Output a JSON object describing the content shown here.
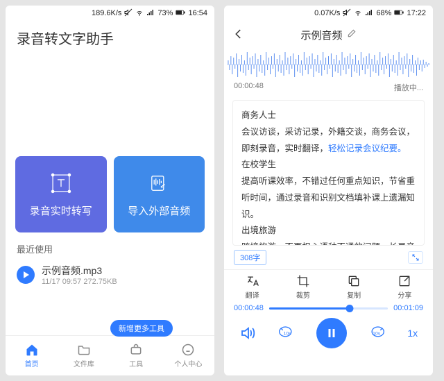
{
  "left": {
    "status": {
      "net": "189.6K/s",
      "battery": "73%",
      "time": "16:54"
    },
    "title": "录音转文字助手",
    "cards": {
      "record": "录音实时转写",
      "import": "导入外部音频"
    },
    "recent_label": "最近使用",
    "recent": {
      "name": "示例音频.mp3",
      "meta": "11/17 09:57   272.75KB"
    },
    "badge": "新增更多工具",
    "tabs": {
      "home": "首页",
      "files": "文件库",
      "tools": "工具",
      "me": "个人中心"
    }
  },
  "right": {
    "status": {
      "net": "0.07K/s",
      "battery": "68%",
      "time": "17:22"
    },
    "title": "示例音频",
    "wave": {
      "pos": "00:00:48",
      "state": "播放中..."
    },
    "transcript": {
      "p1": "商务人士",
      "p2a": "会议访谈，采访记录，外籍交谈，商务会议，即刻录音，实时翻译，",
      "p2b": "轻松记录会议纪要。",
      "p3": "在校学生",
      "p4": "提高听课效率，不错过任何重点知识，节省重听时间，通过录音和识别文档填补课上遗漏知识。",
      "p5": "出境旅游",
      "p6": "跨境旅游，不再担心语种不通的问题，长录音识别，实时翻译，出门放心！"
    },
    "wordcount": "308字",
    "actions": {
      "translate": "翻译",
      "trim": "裁剪",
      "copy": "复制",
      "share": "分享"
    },
    "progress": {
      "cur": "00:00:48",
      "total": "00:01:09"
    },
    "speed": "1x"
  }
}
